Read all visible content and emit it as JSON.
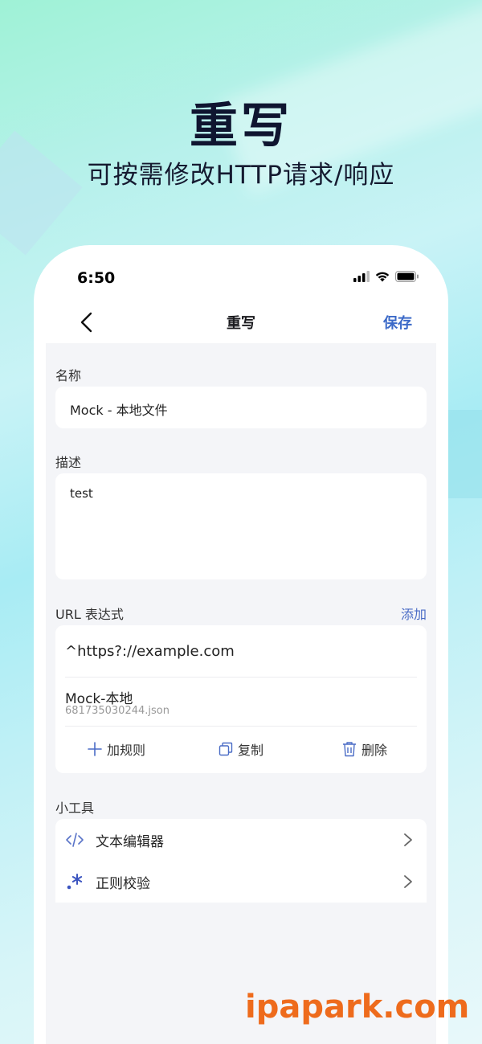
{
  "hero": {
    "title": "重写",
    "subtitle": "可按需修改HTTP请求/响应"
  },
  "status_bar": {
    "time": "6:50"
  },
  "nav": {
    "title": "重写",
    "save_label": "保存"
  },
  "form": {
    "name_label": "名称",
    "name_value": "Mock - 本地文件",
    "desc_label": "描述",
    "desc_value": "test",
    "url_label": "URL 表达式",
    "add_label": "添加"
  },
  "rule": {
    "pattern": "^https?://example.com",
    "mock_title": "Mock-本地",
    "mock_file": "681735030244.json",
    "actions": {
      "add_rule": "加规则",
      "copy": "复制",
      "delete": "删除"
    }
  },
  "tools": {
    "label": "小工具",
    "items": [
      {
        "label": "文本编辑器",
        "icon": "code-icon"
      },
      {
        "label": "正则校验",
        "icon": "regex-icon"
      }
    ]
  },
  "watermark": "ipapark.com",
  "colors": {
    "accent": "#3c6ac8",
    "watermark": "#ee6b1c"
  }
}
